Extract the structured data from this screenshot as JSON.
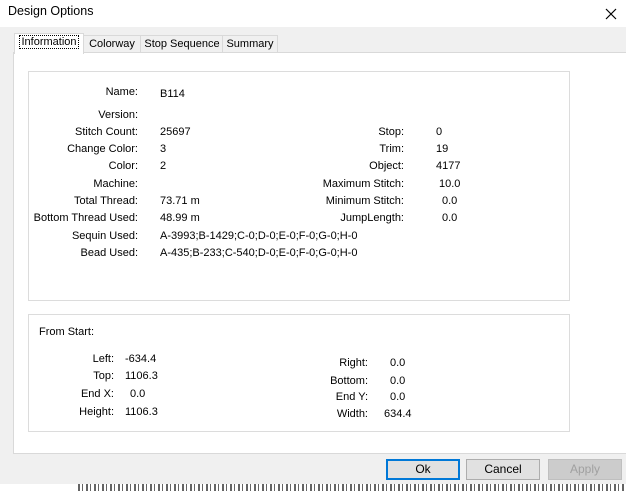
{
  "window": {
    "title": "Design Options"
  },
  "tabs": [
    "Information",
    "Colorway",
    "Stop Sequence",
    "Summary"
  ],
  "info": {
    "name_label": "Name:",
    "name_value": "B114",
    "version_label": "Version:",
    "version_value": "",
    "stitch_count_label": "Stitch Count:",
    "stitch_count_value": "25697",
    "change_color_label": "Change Color:",
    "change_color_value": "3",
    "color_label": "Color:",
    "color_value": "2",
    "machine_label": "Machine:",
    "machine_value": "",
    "total_thread_label": "Total Thread:",
    "total_thread_value": "73.71 m",
    "bottom_thread_label": "Bottom Thread Used:",
    "bottom_thread_value": "48.99 m",
    "sequin_label": "Sequin Used:",
    "sequin_value": "A-3993;B-1429;C-0;D-0;E-0;F-0;G-0;H-0",
    "bead_label": "Bead Used:",
    "bead_value": "A-435;B-233;C-540;D-0;E-0;F-0;G-0;H-0",
    "stop_label": "Stop:",
    "stop_value": "0",
    "trim_label": "Trim:",
    "trim_value": "19",
    "object_label": "Object:",
    "object_value": "4177",
    "max_stitch_label": "Maximum Stitch:",
    "max_stitch_value": "10.0",
    "min_stitch_label": "Minimum Stitch:",
    "min_stitch_value": "0.0",
    "jump_label": "JumpLength:",
    "jump_value": "0.0"
  },
  "from_start": {
    "caption": "From Start:",
    "left_label": "Left:",
    "left_value": "-634.4",
    "top_label": "Top:",
    "top_value": "1106.3",
    "endx_label": "End X:",
    "endx_value": "0.0",
    "height_label": "Height:",
    "height_value": "1106.3",
    "right_label": "Right:",
    "right_value": "0.0",
    "bottom_label": "Bottom:",
    "bottom_value": "0.0",
    "endy_label": "End Y:",
    "endy_value": "0.0",
    "width_label": "Width:",
    "width_value": "634.4"
  },
  "buttons": {
    "ok": "Ok",
    "cancel": "Cancel",
    "apply": "Apply"
  },
  "colors": {
    "accent": "#0078d7",
    "dialog_bg": "#f0f0f0",
    "border": "#d9d9d9"
  }
}
